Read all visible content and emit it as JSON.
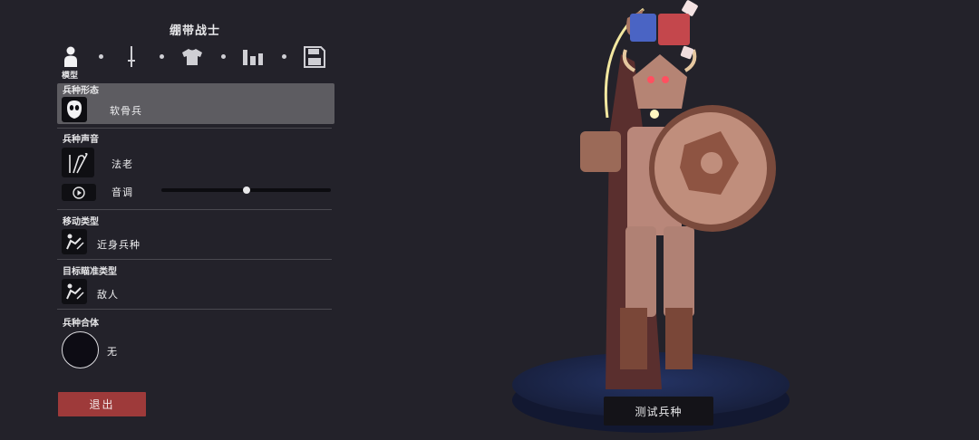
{
  "unit": {
    "name": "绷带战士"
  },
  "tabs": {
    "items": [
      {
        "icon": "person-icon",
        "label": "模型"
      },
      {
        "icon": "sword-icon",
        "label": ""
      },
      {
        "icon": "shirt-icon",
        "label": ""
      },
      {
        "icon": "stats-icon",
        "label": ""
      },
      {
        "icon": "save-icon",
        "label": ""
      }
    ]
  },
  "sections": {
    "form": {
      "label": "兵种形态",
      "value": "软骨兵",
      "icon": "mask-icon"
    },
    "voice": {
      "label": "兵种声音",
      "value": "法老",
      "icon": "staff-icon",
      "pitch_label": "音调",
      "pitch_value": 0.5,
      "play_icon": "play-icon"
    },
    "movement": {
      "label": "移动类型",
      "value": "近身兵种",
      "icon": "melee-icon"
    },
    "targeting": {
      "label": "目标瞄准类型",
      "value": "敌人",
      "icon": "target-enemy-icon"
    },
    "merge": {
      "label": "兵种合体",
      "value": "无"
    }
  },
  "buttons": {
    "exit": "退出",
    "test": "测试兵种"
  },
  "colors": {
    "primary": "#4a64c4",
    "secondary": "#c4474c",
    "exit_button": "#9e3a3a",
    "panel_bg": "#23222a"
  }
}
